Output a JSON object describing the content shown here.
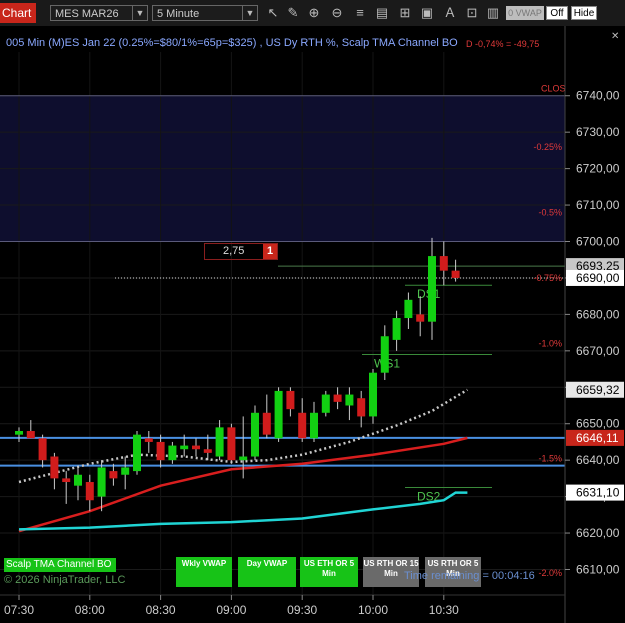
{
  "toolbar": {
    "tab_label": "Chart",
    "instrument": "MES MAR26",
    "timeframe": "5 Minute",
    "icons": [
      "draw-icon",
      "pencil-icon",
      "zoom-in-icon",
      "zoom-out-icon",
      "properties-icon",
      "strategy-icon",
      "templates-icon",
      "window-icon",
      "text-icon",
      "grid-icon"
    ],
    "vwap_button": "0 VWAP",
    "toggle_off": "Off",
    "toggle_hide": "Hide"
  },
  "chart": {
    "title": "005 Min (M)ES Jan 22 (0.25%=$80/1%=65p=$325) , US Dy RTH %, Scalp TMA Channel BO",
    "pnl_label": "D -0,74% = -49,75",
    "close_label": "CLOS",
    "position": {
      "price_diff": "2,75",
      "quantity": "1"
    },
    "timer_text": "Time remaining = 00:04:16",
    "copyright": "© 2026 NinjaTrader, LLC",
    "indicator_label": "Scalp TMA Channel BO",
    "buttons": [
      {
        "label": "Wkly VWAP",
        "style": "green"
      },
      {
        "label": "Day VWAP",
        "style": "green"
      },
      {
        "label": "US ETH OR 5 Min",
        "style": "green"
      },
      {
        "label": "US RTH OR 15 Min",
        "style": "gray"
      },
      {
        "label": "US RTH OR 5 Min",
        "style": "gray"
      }
    ],
    "levels": [
      {
        "label": "WS1",
        "price": 6669
      },
      {
        "label": "DS1",
        "price": 6688
      },
      {
        "label": "DS2",
        "price": 6632.5
      }
    ],
    "percent_labels": [
      {
        "label": "-0.25%",
        "price": 6726
      },
      {
        "label": "-0.5%",
        "price": 6708
      },
      {
        "label": "-0.75%",
        "price": 6690
      },
      {
        "label": "-1.0%",
        "price": 6672
      },
      {
        "label": "-1.5%",
        "price": 6640.5
      },
      {
        "label": "-2.0%",
        "price": 6609
      }
    ],
    "price_badges": [
      {
        "label": "6693,25",
        "price": 6693.25,
        "bg": "#c8c8c8",
        "fg": "#000000"
      },
      {
        "label": "6690,00",
        "price": 6690,
        "bg": "#ffffff",
        "fg": "#000000"
      },
      {
        "label": "6659,32",
        "price": 6659.32,
        "bg": "#e8e8e8",
        "fg": "#000000"
      },
      {
        "label": "6646,11",
        "price": 6646.11,
        "bg": "#c8261b",
        "fg": "#ffffff"
      },
      {
        "label": "6631,10",
        "price": 6631.1,
        "bg": "#ffffff",
        "fg": "#000000"
      }
    ]
  },
  "chart_data": {
    "type": "candlestick",
    "ylim": [
      6603,
      6752
    ],
    "y_ticks": [
      "6610,00",
      "6620,00",
      "6630,00",
      "6640,00",
      "6650,00",
      "6660,00",
      "6670,00",
      "6680,00",
      "6690,00",
      "6700,00",
      "6710,00",
      "6720,00",
      "6730,00",
      "6740,00"
    ],
    "y_tick_values": [
      6610,
      6620,
      6630,
      6640,
      6650,
      6660,
      6670,
      6680,
      6690,
      6700,
      6710,
      6720,
      6730,
      6740
    ],
    "x_ticks": [
      "07:30",
      "08:00",
      "08:30",
      "09:00",
      "09:30",
      "10:00",
      "10:30"
    ],
    "x_tick_index": [
      0,
      6,
      12,
      18,
      24,
      30,
      36
    ],
    "candles": [
      {
        "o": 6647,
        "h": 6649,
        "l": 6645,
        "c": 6648
      },
      {
        "o": 6648,
        "h": 6651,
        "l": 6646,
        "c": 6646
      },
      {
        "o": 6646,
        "h": 6647,
        "l": 6638,
        "c": 6640
      },
      {
        "o": 6641,
        "h": 6642,
        "l": 6632,
        "c": 6635
      },
      {
        "o": 6635,
        "h": 6637,
        "l": 6628,
        "c": 6634
      },
      {
        "o": 6633,
        "h": 6638,
        "l": 6629,
        "c": 6636
      },
      {
        "o": 6634,
        "h": 6636,
        "l": 6626,
        "c": 6629
      },
      {
        "o": 6630,
        "h": 6640,
        "l": 6626,
        "c": 6638
      },
      {
        "o": 6637,
        "h": 6639,
        "l": 6633,
        "c": 6635
      },
      {
        "o": 6636,
        "h": 6641,
        "l": 6632,
        "c": 6638
      },
      {
        "o": 6637,
        "h": 6648,
        "l": 6636,
        "c": 6647
      },
      {
        "o": 6646,
        "h": 6648,
        "l": 6642,
        "c": 6645
      },
      {
        "o": 6645,
        "h": 6647,
        "l": 6638,
        "c": 6640
      },
      {
        "o": 6640,
        "h": 6645,
        "l": 6639,
        "c": 6644
      },
      {
        "o": 6643,
        "h": 6647,
        "l": 6641,
        "c": 6644
      },
      {
        "o": 6644,
        "h": 6646,
        "l": 6641,
        "c": 6643
      },
      {
        "o": 6643,
        "h": 6647,
        "l": 6640,
        "c": 6642
      },
      {
        "o": 6641,
        "h": 6651,
        "l": 6640,
        "c": 6649
      },
      {
        "o": 6649,
        "h": 6650,
        "l": 6639,
        "c": 6640
      },
      {
        "o": 6640,
        "h": 6652,
        "l": 6635,
        "c": 6641
      },
      {
        "o": 6641,
        "h": 6655,
        "l": 6640,
        "c": 6653
      },
      {
        "o": 6653,
        "h": 6658,
        "l": 6646,
        "c": 6647
      },
      {
        "o": 6646,
        "h": 6660,
        "l": 6645,
        "c": 6659
      },
      {
        "o": 6659,
        "h": 6660,
        "l": 6652,
        "c": 6654
      },
      {
        "o": 6653,
        "h": 6657,
        "l": 6645,
        "c": 6646
      },
      {
        "o": 6646,
        "h": 6656,
        "l": 6645,
        "c": 6653
      },
      {
        "o": 6653,
        "h": 6659,
        "l": 6652,
        "c": 6658
      },
      {
        "o": 6658,
        "h": 6660,
        "l": 6654,
        "c": 6656
      },
      {
        "o": 6655,
        "h": 6660,
        "l": 6651,
        "c": 6658
      },
      {
        "o": 6657,
        "h": 6659,
        "l": 6649,
        "c": 6652
      },
      {
        "o": 6652,
        "h": 6665,
        "l": 6650,
        "c": 6664
      },
      {
        "o": 6664,
        "h": 6677,
        "l": 6662,
        "c": 6674
      },
      {
        "o": 6673,
        "h": 6681,
        "l": 6670,
        "c": 6679
      },
      {
        "o": 6679,
        "h": 6686,
        "l": 6676,
        "c": 6684
      },
      {
        "o": 6680,
        "h": 6685,
        "l": 6674,
        "c": 6678
      },
      {
        "o": 6678,
        "h": 6701,
        "l": 6673,
        "c": 6696
      },
      {
        "o": 6696,
        "h": 6700,
        "l": 6688,
        "c": 6692
      },
      {
        "o": 6692,
        "h": 6695,
        "l": 6689,
        "c": 6690
      }
    ],
    "horizontal_lines": [
      {
        "price": 6646.11,
        "color": "#4a90e2"
      },
      {
        "price": 6638.5,
        "color": "#4a90e2"
      }
    ],
    "series": [
      {
        "color": "#d81e1e",
        "style": "solid",
        "points": [
          [
            0,
            6620.5
          ],
          [
            6,
            6626
          ],
          [
            12,
            6633
          ],
          [
            18,
            6637.5
          ],
          [
            24,
            6639
          ],
          [
            30,
            6641.5
          ],
          [
            36,
            6644.5
          ],
          [
            38,
            6646.11
          ]
        ]
      },
      {
        "color": "#c8c8c8",
        "style": "dotted",
        "points": [
          [
            0,
            6634
          ],
          [
            3,
            6636.5
          ],
          [
            6,
            6639
          ],
          [
            10,
            6641.5
          ],
          [
            14,
            6641
          ],
          [
            18,
            6639.5
          ],
          [
            21,
            6640
          ],
          [
            24,
            6641.5
          ],
          [
            28,
            6645
          ],
          [
            32,
            6649.5
          ],
          [
            35,
            6653.5
          ],
          [
            38,
            6659.32
          ]
        ]
      },
      {
        "color": "#20d4d4",
        "style": "solid",
        "points": [
          [
            0,
            6621
          ],
          [
            6,
            6621.5
          ],
          [
            12,
            6622.5
          ],
          [
            18,
            6623
          ],
          [
            24,
            6624
          ],
          [
            30,
            6626.5
          ],
          [
            34,
            6628
          ],
          [
            36,
            6629
          ],
          [
            37,
            6631.1
          ],
          [
            38,
            6631.1
          ]
        ]
      }
    ]
  }
}
